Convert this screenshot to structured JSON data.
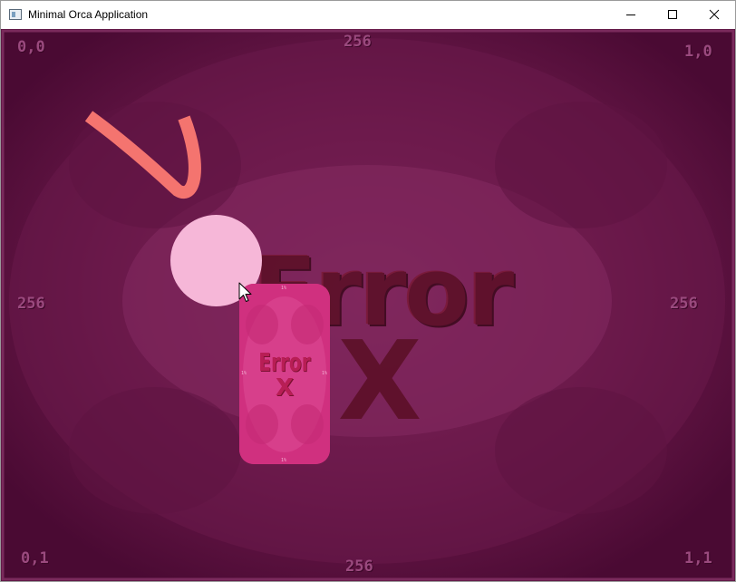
{
  "window": {
    "title": "Minimal Orca Application",
    "icon": "app-window-icon",
    "controls": {
      "minimize_icon": "minimize-icon",
      "maximize_icon": "maximize-icon",
      "close_icon": "close-icon"
    }
  },
  "canvas": {
    "background_color": "#5a0f3d",
    "texture_labels": {
      "top_left": "0,0",
      "top_center": "256",
      "top_right": "1,0",
      "left_center": "256",
      "right_center": "256",
      "bottom_left": "0,1",
      "bottom_center": "256",
      "bottom_right": "1,1"
    },
    "background_text": {
      "main": "Error",
      "mark": "X"
    },
    "stroke_color": "#f4746f",
    "circle_color": "#f6b7d8",
    "card": {
      "color": "#d0307f",
      "text_main": "Error",
      "text_mark": "X",
      "label_top": "1%",
      "label_left": "1%",
      "label_right": "1%",
      "label_bottom": "1%"
    },
    "cursor_icon": "mouse-pointer-icon"
  }
}
